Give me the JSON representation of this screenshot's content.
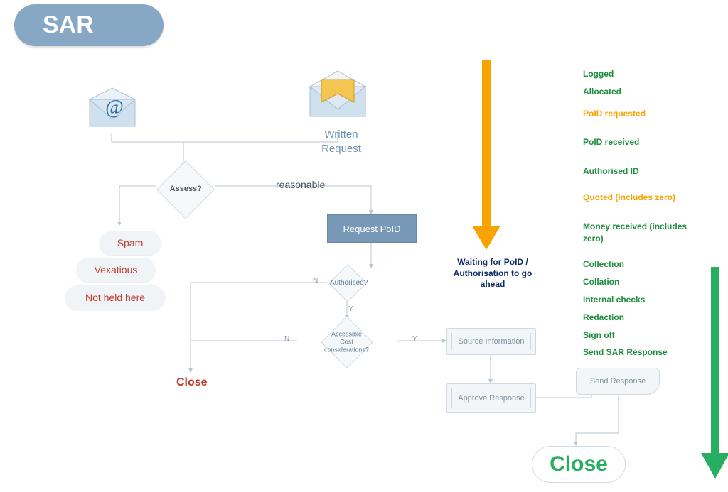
{
  "title": "SAR",
  "nodes": {
    "written_request": "Written\nRequest",
    "assess": "Assess?",
    "reasonable": "reasonable",
    "request_poid": "Request PoID",
    "authorised": "Authorised?",
    "accessible": "Accessible\nCost considerations?",
    "source_info": "Source Information",
    "approve_response": "Approve Response",
    "send_response": "Send Response",
    "close_red": "Close",
    "close_green": "Close",
    "spam": "Spam",
    "vexatious": "Vexatious",
    "not_held": "Not held here"
  },
  "labels": {
    "yes": "Y",
    "no": "N"
  },
  "arrows": {
    "waiting": "Waiting for PoID / Authorisation to go ahead"
  },
  "legend": [
    {
      "text": "Logged",
      "c": "g"
    },
    {
      "text": "Allocated",
      "c": "g"
    },
    {
      "text": "PoID requested",
      "c": "o"
    },
    {
      "text": "PoID received",
      "c": "g"
    },
    {
      "text": "Authorised ID",
      "c": "g"
    },
    {
      "text": "Quoted (includes zero)",
      "c": "o"
    },
    {
      "text": "Money received (includes zero)",
      "c": "g"
    },
    {
      "text": "Collection",
      "c": "g"
    },
    {
      "text": "Collation",
      "c": "g"
    },
    {
      "text": "Internal checks",
      "c": "g"
    },
    {
      "text": "Redaction",
      "c": "g"
    },
    {
      "text": "Sign off",
      "c": "g"
    },
    {
      "text": "Send SAR Response",
      "c": "g"
    }
  ],
  "chart_data": {
    "type": "flowchart",
    "title": "SAR",
    "nodes": [
      {
        "id": "email_in",
        "kind": "input-icon",
        "label": "Email request (@)"
      },
      {
        "id": "written_in",
        "kind": "input-icon",
        "label": "Written Request"
      },
      {
        "id": "assess",
        "kind": "decision",
        "label": "Assess?"
      },
      {
        "id": "spam",
        "kind": "terminator",
        "label": "Spam"
      },
      {
        "id": "vexatious",
        "kind": "terminator",
        "label": "Vexatious"
      },
      {
        "id": "not_held",
        "kind": "terminator",
        "label": "Not held here"
      },
      {
        "id": "request_poid",
        "kind": "process",
        "label": "Request PoID"
      },
      {
        "id": "authorised",
        "kind": "decision",
        "label": "Authorised?"
      },
      {
        "id": "accessible",
        "kind": "decision",
        "label": "Accessible / Cost considerations?"
      },
      {
        "id": "close",
        "kind": "terminator",
        "label": "Close"
      },
      {
        "id": "source_info",
        "kind": "process",
        "label": "Source Information"
      },
      {
        "id": "approve_resp",
        "kind": "process",
        "label": "Approve Response"
      },
      {
        "id": "send_resp",
        "kind": "process",
        "label": "Send Response"
      },
      {
        "id": "close_end",
        "kind": "terminator",
        "label": "Close"
      }
    ],
    "edges": [
      {
        "from": "email_in",
        "to": "assess"
      },
      {
        "from": "written_in",
        "to": "assess"
      },
      {
        "from": "assess",
        "to": "spam",
        "label": ""
      },
      {
        "from": "assess",
        "to": "vexatious",
        "label": ""
      },
      {
        "from": "assess",
        "to": "not_held",
        "label": ""
      },
      {
        "from": "assess",
        "to": "request_poid",
        "label": "reasonable"
      },
      {
        "from": "request_poid",
        "to": "authorised"
      },
      {
        "from": "authorised",
        "to": "close",
        "label": "N"
      },
      {
        "from": "authorised",
        "to": "accessible",
        "label": "Y"
      },
      {
        "from": "accessible",
        "to": "close",
        "label": "N"
      },
      {
        "from": "accessible",
        "to": "source_info",
        "label": "Y"
      },
      {
        "from": "source_info",
        "to": "approve_resp"
      },
      {
        "from": "approve_resp",
        "to": "send_resp"
      },
      {
        "from": "send_resp",
        "to": "close_end"
      }
    ],
    "side_arrows": [
      {
        "color": "#f7a400",
        "label": "Waiting for PoID / Authorisation to go ahead",
        "covers": [
          "PoID requested",
          "PoID received",
          "Authorised ID",
          "Quoted (includes zero)",
          "Money received (includes zero)"
        ]
      },
      {
        "color": "#27ae60",
        "label": "",
        "covers": [
          "Collection",
          "Collation",
          "Internal checks",
          "Redaction",
          "Sign off",
          "Send SAR Response"
        ]
      }
    ],
    "legend_steps": [
      "Logged",
      "Allocated",
      "PoID requested",
      "PoID received",
      "Authorised ID",
      "Quoted (includes zero)",
      "Money received (includes zero)",
      "Collection",
      "Collation",
      "Internal checks",
      "Redaction",
      "Sign off",
      "Send SAR Response"
    ]
  }
}
